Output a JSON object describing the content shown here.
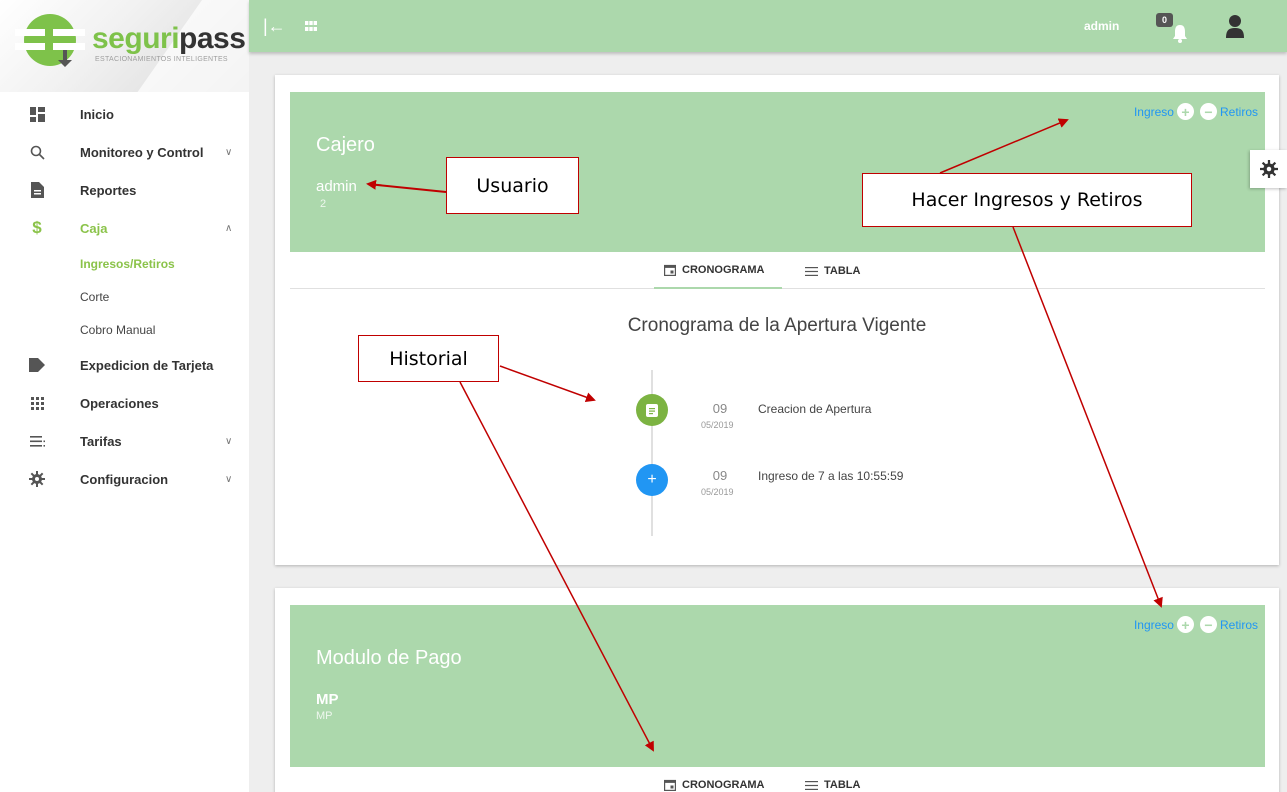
{
  "brand": {
    "name_colored": "seguri",
    "name_dark": "pass",
    "tagline": "ESTACIONAMIENTOS INTELIGENTES"
  },
  "sidebar": {
    "items": [
      {
        "label": "Inicio",
        "icon": "dashboard-icon"
      },
      {
        "label": "Monitoreo y Control",
        "icon": "search-icon",
        "chevron": "∨"
      },
      {
        "label": "Reportes",
        "icon": "document-icon"
      },
      {
        "label": "Caja",
        "icon": "dollar-icon",
        "chevron": "∧"
      },
      {
        "label": "Expedicion de Tarjeta",
        "icon": "tag-icon"
      },
      {
        "label": "Operaciones",
        "icon": "apps-icon"
      },
      {
        "label": "Tarifas",
        "icon": "list-icon",
        "chevron": "∨"
      },
      {
        "label": "Configuracion",
        "icon": "gear-icon",
        "chevron": "∨"
      }
    ],
    "caja_sub": [
      {
        "label": "Ingresos/Retiros"
      },
      {
        "label": "Corte"
      },
      {
        "label": "Cobro Manual"
      }
    ]
  },
  "topbar": {
    "user": "admin",
    "notifications": "0"
  },
  "cards": [
    {
      "title": "Cajero",
      "user": "admin",
      "sub": "2",
      "actions": {
        "ingreso": "Ingreso",
        "retiros": "Retiros"
      },
      "tabs": [
        "CRONOGRAMA",
        "TABLA"
      ]
    },
    {
      "title": "Modulo de Pago",
      "user": "MP",
      "sub": "MP",
      "actions": {
        "ingreso": "Ingreso",
        "retiros": "Retiros"
      },
      "tabs": [
        "CRONOGRAMA",
        "TABLA"
      ]
    }
  ],
  "cronograma": {
    "title": "Cronograma de la Apertura Vigente",
    "events": [
      {
        "day": "09",
        "month": "05/2019",
        "text": "Creacion de Apertura",
        "icon": "document-icon"
      },
      {
        "day": "09",
        "month": "05/2019",
        "text": "Ingreso de 7 a las 10:55:59",
        "icon": "plus-icon"
      }
    ]
  },
  "annotations": {
    "usuario": "Usuario",
    "historial": "Historial",
    "hacer": "Hacer Ingresos y Retiros"
  },
  "colors": {
    "accent_green": "#8bc34a",
    "banner_green": "#acd8ac",
    "link_blue": "#2196f3",
    "annotation_red": "#c00000"
  }
}
